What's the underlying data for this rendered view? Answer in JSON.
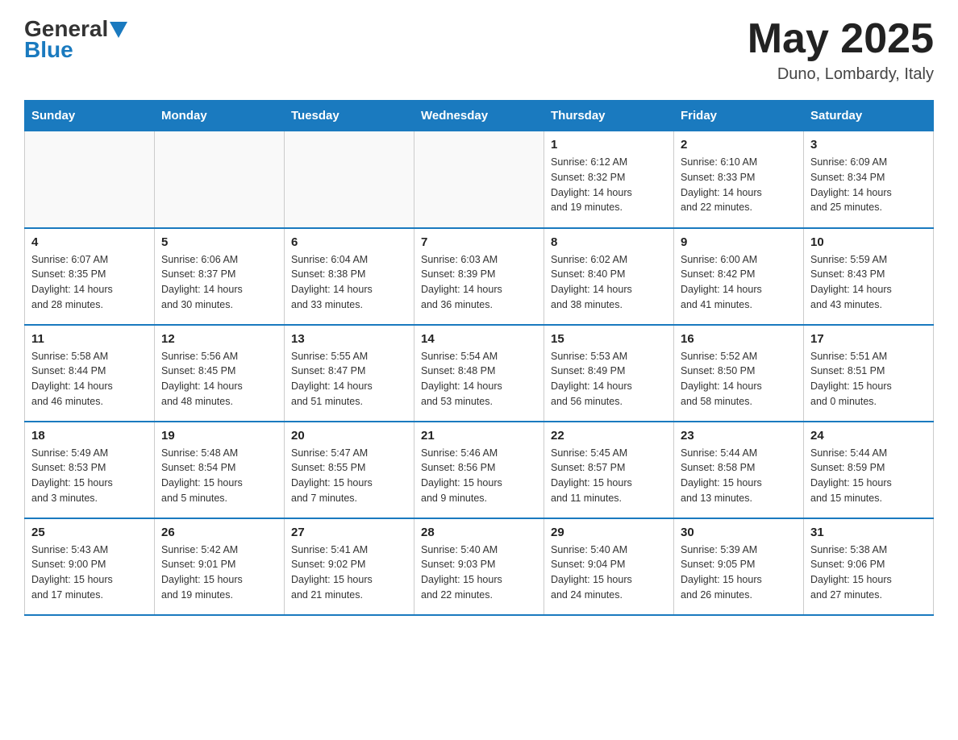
{
  "logo": {
    "general": "General",
    "blue": "Blue"
  },
  "title": "May 2025",
  "location": "Duno, Lombardy, Italy",
  "days_of_week": [
    "Sunday",
    "Monday",
    "Tuesday",
    "Wednesday",
    "Thursday",
    "Friday",
    "Saturday"
  ],
  "weeks": [
    [
      {
        "day": "",
        "info": ""
      },
      {
        "day": "",
        "info": ""
      },
      {
        "day": "",
        "info": ""
      },
      {
        "day": "",
        "info": ""
      },
      {
        "day": "1",
        "info": "Sunrise: 6:12 AM\nSunset: 8:32 PM\nDaylight: 14 hours\nand 19 minutes."
      },
      {
        "day": "2",
        "info": "Sunrise: 6:10 AM\nSunset: 8:33 PM\nDaylight: 14 hours\nand 22 minutes."
      },
      {
        "day": "3",
        "info": "Sunrise: 6:09 AM\nSunset: 8:34 PM\nDaylight: 14 hours\nand 25 minutes."
      }
    ],
    [
      {
        "day": "4",
        "info": "Sunrise: 6:07 AM\nSunset: 8:35 PM\nDaylight: 14 hours\nand 28 minutes."
      },
      {
        "day": "5",
        "info": "Sunrise: 6:06 AM\nSunset: 8:37 PM\nDaylight: 14 hours\nand 30 minutes."
      },
      {
        "day": "6",
        "info": "Sunrise: 6:04 AM\nSunset: 8:38 PM\nDaylight: 14 hours\nand 33 minutes."
      },
      {
        "day": "7",
        "info": "Sunrise: 6:03 AM\nSunset: 8:39 PM\nDaylight: 14 hours\nand 36 minutes."
      },
      {
        "day": "8",
        "info": "Sunrise: 6:02 AM\nSunset: 8:40 PM\nDaylight: 14 hours\nand 38 minutes."
      },
      {
        "day": "9",
        "info": "Sunrise: 6:00 AM\nSunset: 8:42 PM\nDaylight: 14 hours\nand 41 minutes."
      },
      {
        "day": "10",
        "info": "Sunrise: 5:59 AM\nSunset: 8:43 PM\nDaylight: 14 hours\nand 43 minutes."
      }
    ],
    [
      {
        "day": "11",
        "info": "Sunrise: 5:58 AM\nSunset: 8:44 PM\nDaylight: 14 hours\nand 46 minutes."
      },
      {
        "day": "12",
        "info": "Sunrise: 5:56 AM\nSunset: 8:45 PM\nDaylight: 14 hours\nand 48 minutes."
      },
      {
        "day": "13",
        "info": "Sunrise: 5:55 AM\nSunset: 8:47 PM\nDaylight: 14 hours\nand 51 minutes."
      },
      {
        "day": "14",
        "info": "Sunrise: 5:54 AM\nSunset: 8:48 PM\nDaylight: 14 hours\nand 53 minutes."
      },
      {
        "day": "15",
        "info": "Sunrise: 5:53 AM\nSunset: 8:49 PM\nDaylight: 14 hours\nand 56 minutes."
      },
      {
        "day": "16",
        "info": "Sunrise: 5:52 AM\nSunset: 8:50 PM\nDaylight: 14 hours\nand 58 minutes."
      },
      {
        "day": "17",
        "info": "Sunrise: 5:51 AM\nSunset: 8:51 PM\nDaylight: 15 hours\nand 0 minutes."
      }
    ],
    [
      {
        "day": "18",
        "info": "Sunrise: 5:49 AM\nSunset: 8:53 PM\nDaylight: 15 hours\nand 3 minutes."
      },
      {
        "day": "19",
        "info": "Sunrise: 5:48 AM\nSunset: 8:54 PM\nDaylight: 15 hours\nand 5 minutes."
      },
      {
        "day": "20",
        "info": "Sunrise: 5:47 AM\nSunset: 8:55 PM\nDaylight: 15 hours\nand 7 minutes."
      },
      {
        "day": "21",
        "info": "Sunrise: 5:46 AM\nSunset: 8:56 PM\nDaylight: 15 hours\nand 9 minutes."
      },
      {
        "day": "22",
        "info": "Sunrise: 5:45 AM\nSunset: 8:57 PM\nDaylight: 15 hours\nand 11 minutes."
      },
      {
        "day": "23",
        "info": "Sunrise: 5:44 AM\nSunset: 8:58 PM\nDaylight: 15 hours\nand 13 minutes."
      },
      {
        "day": "24",
        "info": "Sunrise: 5:44 AM\nSunset: 8:59 PM\nDaylight: 15 hours\nand 15 minutes."
      }
    ],
    [
      {
        "day": "25",
        "info": "Sunrise: 5:43 AM\nSunset: 9:00 PM\nDaylight: 15 hours\nand 17 minutes."
      },
      {
        "day": "26",
        "info": "Sunrise: 5:42 AM\nSunset: 9:01 PM\nDaylight: 15 hours\nand 19 minutes."
      },
      {
        "day": "27",
        "info": "Sunrise: 5:41 AM\nSunset: 9:02 PM\nDaylight: 15 hours\nand 21 minutes."
      },
      {
        "day": "28",
        "info": "Sunrise: 5:40 AM\nSunset: 9:03 PM\nDaylight: 15 hours\nand 22 minutes."
      },
      {
        "day": "29",
        "info": "Sunrise: 5:40 AM\nSunset: 9:04 PM\nDaylight: 15 hours\nand 24 minutes."
      },
      {
        "day": "30",
        "info": "Sunrise: 5:39 AM\nSunset: 9:05 PM\nDaylight: 15 hours\nand 26 minutes."
      },
      {
        "day": "31",
        "info": "Sunrise: 5:38 AM\nSunset: 9:06 PM\nDaylight: 15 hours\nand 27 minutes."
      }
    ]
  ]
}
